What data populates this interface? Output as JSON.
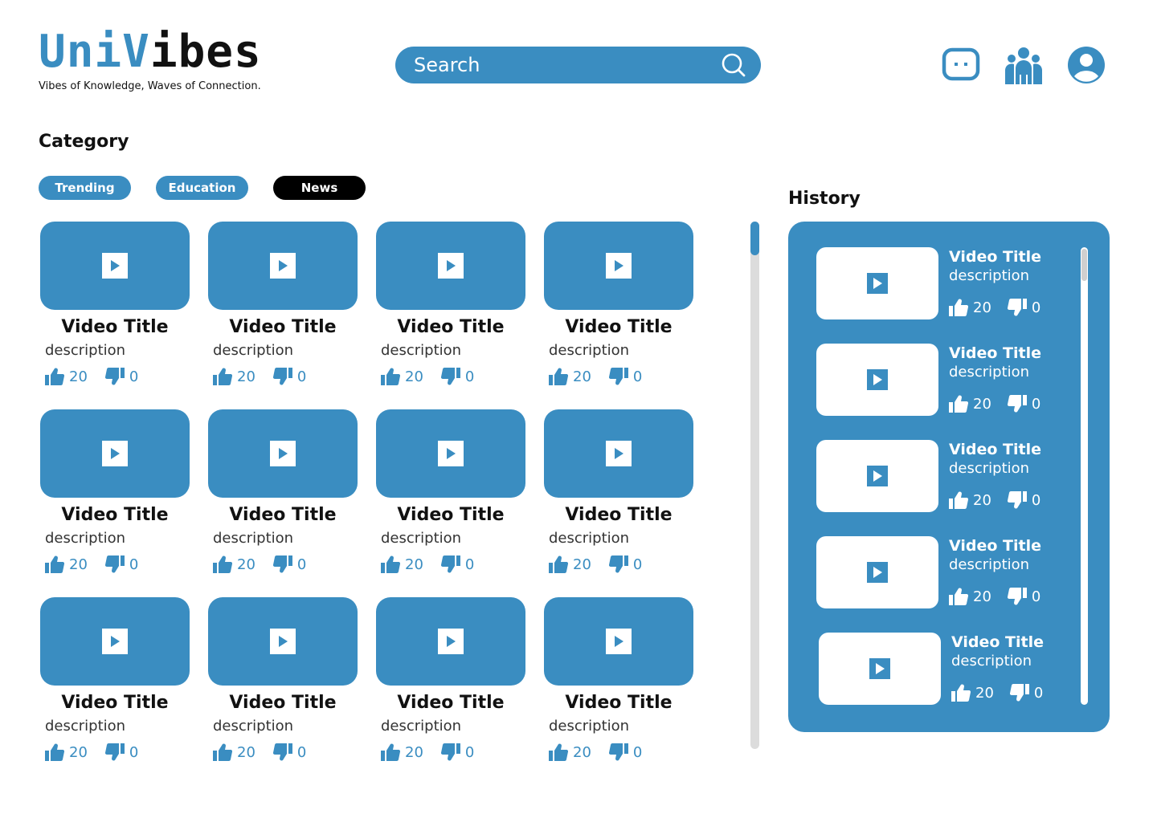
{
  "header": {
    "logo_part1": "Uni",
    "logo_part2": "V",
    "logo_part3": "ibes",
    "tagline": "Vibes of Knowledge, Waves of Connection.",
    "search_placeholder": "Search",
    "icons": [
      "chat-icon",
      "community-icon",
      "profile-icon"
    ]
  },
  "category": {
    "title": "Category",
    "chips": [
      {
        "label": "Trending",
        "active": false
      },
      {
        "label": "Education",
        "active": false
      },
      {
        "label": "News",
        "active": true
      }
    ]
  },
  "videos": [
    {
      "title": "Video Title",
      "description": "description",
      "likes": "20",
      "dislikes": "0"
    },
    {
      "title": "Video Title",
      "description": "description",
      "likes": "20",
      "dislikes": "0"
    },
    {
      "title": "Video Title",
      "description": "description",
      "likes": "20",
      "dislikes": "0"
    },
    {
      "title": "Video Title",
      "description": "description",
      "likes": "20",
      "dislikes": "0"
    },
    {
      "title": "Video Title",
      "description": "description",
      "likes": "20",
      "dislikes": "0"
    },
    {
      "title": "Video Title",
      "description": "description",
      "likes": "20",
      "dislikes": "0"
    },
    {
      "title": "Video Title",
      "description": "description",
      "likes": "20",
      "dislikes": "0"
    },
    {
      "title": "Video Title",
      "description": "description",
      "likes": "20",
      "dislikes": "0"
    },
    {
      "title": "Video Title",
      "description": "description",
      "likes": "20",
      "dislikes": "0"
    },
    {
      "title": "Video Title",
      "description": "description",
      "likes": "20",
      "dislikes": "0"
    },
    {
      "title": "Video Title",
      "description": "description",
      "likes": "20",
      "dislikes": "0"
    },
    {
      "title": "Video Title",
      "description": "description",
      "likes": "20",
      "dislikes": "0"
    }
  ],
  "history": {
    "title": "History",
    "items": [
      {
        "title": "Video Title",
        "description": "description",
        "likes": "20",
        "dislikes": "0"
      },
      {
        "title": "Video Title",
        "description": "description",
        "likes": "20",
        "dislikes": "0"
      },
      {
        "title": "Video Title",
        "description": "description",
        "likes": "20",
        "dislikes": "0"
      },
      {
        "title": "Video Title",
        "description": "description",
        "likes": "20",
        "dislikes": "0"
      },
      {
        "title": "Video Title",
        "description": "description",
        "likes": "20",
        "dislikes": "0"
      }
    ]
  },
  "colors": {
    "accent": "#3a8dc1",
    "active_chip": "#000000",
    "scroll_track": "#dcdcdc"
  }
}
